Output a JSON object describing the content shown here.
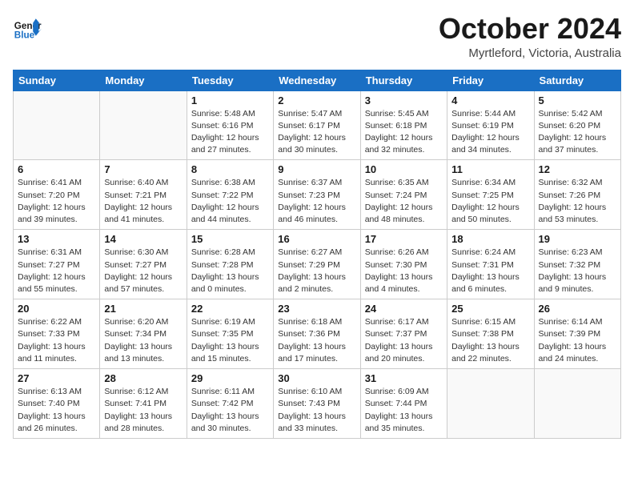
{
  "header": {
    "logo_line1": "General",
    "logo_line2": "Blue",
    "month": "October 2024",
    "location": "Myrtleford, Victoria, Australia"
  },
  "weekdays": [
    "Sunday",
    "Monday",
    "Tuesday",
    "Wednesday",
    "Thursday",
    "Friday",
    "Saturday"
  ],
  "weeks": [
    [
      {
        "day": "",
        "info": ""
      },
      {
        "day": "",
        "info": ""
      },
      {
        "day": "1",
        "info": "Sunrise: 5:48 AM\nSunset: 6:16 PM\nDaylight: 12 hours\nand 27 minutes."
      },
      {
        "day": "2",
        "info": "Sunrise: 5:47 AM\nSunset: 6:17 PM\nDaylight: 12 hours\nand 30 minutes."
      },
      {
        "day": "3",
        "info": "Sunrise: 5:45 AM\nSunset: 6:18 PM\nDaylight: 12 hours\nand 32 minutes."
      },
      {
        "day": "4",
        "info": "Sunrise: 5:44 AM\nSunset: 6:19 PM\nDaylight: 12 hours\nand 34 minutes."
      },
      {
        "day": "5",
        "info": "Sunrise: 5:42 AM\nSunset: 6:20 PM\nDaylight: 12 hours\nand 37 minutes."
      }
    ],
    [
      {
        "day": "6",
        "info": "Sunrise: 6:41 AM\nSunset: 7:20 PM\nDaylight: 12 hours\nand 39 minutes."
      },
      {
        "day": "7",
        "info": "Sunrise: 6:40 AM\nSunset: 7:21 PM\nDaylight: 12 hours\nand 41 minutes."
      },
      {
        "day": "8",
        "info": "Sunrise: 6:38 AM\nSunset: 7:22 PM\nDaylight: 12 hours\nand 44 minutes."
      },
      {
        "day": "9",
        "info": "Sunrise: 6:37 AM\nSunset: 7:23 PM\nDaylight: 12 hours\nand 46 minutes."
      },
      {
        "day": "10",
        "info": "Sunrise: 6:35 AM\nSunset: 7:24 PM\nDaylight: 12 hours\nand 48 minutes."
      },
      {
        "day": "11",
        "info": "Sunrise: 6:34 AM\nSunset: 7:25 PM\nDaylight: 12 hours\nand 50 minutes."
      },
      {
        "day": "12",
        "info": "Sunrise: 6:32 AM\nSunset: 7:26 PM\nDaylight: 12 hours\nand 53 minutes."
      }
    ],
    [
      {
        "day": "13",
        "info": "Sunrise: 6:31 AM\nSunset: 7:27 PM\nDaylight: 12 hours\nand 55 minutes."
      },
      {
        "day": "14",
        "info": "Sunrise: 6:30 AM\nSunset: 7:27 PM\nDaylight: 12 hours\nand 57 minutes."
      },
      {
        "day": "15",
        "info": "Sunrise: 6:28 AM\nSunset: 7:28 PM\nDaylight: 13 hours\nand 0 minutes."
      },
      {
        "day": "16",
        "info": "Sunrise: 6:27 AM\nSunset: 7:29 PM\nDaylight: 13 hours\nand 2 minutes."
      },
      {
        "day": "17",
        "info": "Sunrise: 6:26 AM\nSunset: 7:30 PM\nDaylight: 13 hours\nand 4 minutes."
      },
      {
        "day": "18",
        "info": "Sunrise: 6:24 AM\nSunset: 7:31 PM\nDaylight: 13 hours\nand 6 minutes."
      },
      {
        "day": "19",
        "info": "Sunrise: 6:23 AM\nSunset: 7:32 PM\nDaylight: 13 hours\nand 9 minutes."
      }
    ],
    [
      {
        "day": "20",
        "info": "Sunrise: 6:22 AM\nSunset: 7:33 PM\nDaylight: 13 hours\nand 11 minutes."
      },
      {
        "day": "21",
        "info": "Sunrise: 6:20 AM\nSunset: 7:34 PM\nDaylight: 13 hours\nand 13 minutes."
      },
      {
        "day": "22",
        "info": "Sunrise: 6:19 AM\nSunset: 7:35 PM\nDaylight: 13 hours\nand 15 minutes."
      },
      {
        "day": "23",
        "info": "Sunrise: 6:18 AM\nSunset: 7:36 PM\nDaylight: 13 hours\nand 17 minutes."
      },
      {
        "day": "24",
        "info": "Sunrise: 6:17 AM\nSunset: 7:37 PM\nDaylight: 13 hours\nand 20 minutes."
      },
      {
        "day": "25",
        "info": "Sunrise: 6:15 AM\nSunset: 7:38 PM\nDaylight: 13 hours\nand 22 minutes."
      },
      {
        "day": "26",
        "info": "Sunrise: 6:14 AM\nSunset: 7:39 PM\nDaylight: 13 hours\nand 24 minutes."
      }
    ],
    [
      {
        "day": "27",
        "info": "Sunrise: 6:13 AM\nSunset: 7:40 PM\nDaylight: 13 hours\nand 26 minutes."
      },
      {
        "day": "28",
        "info": "Sunrise: 6:12 AM\nSunset: 7:41 PM\nDaylight: 13 hours\nand 28 minutes."
      },
      {
        "day": "29",
        "info": "Sunrise: 6:11 AM\nSunset: 7:42 PM\nDaylight: 13 hours\nand 30 minutes."
      },
      {
        "day": "30",
        "info": "Sunrise: 6:10 AM\nSunset: 7:43 PM\nDaylight: 13 hours\nand 33 minutes."
      },
      {
        "day": "31",
        "info": "Sunrise: 6:09 AM\nSunset: 7:44 PM\nDaylight: 13 hours\nand 35 minutes."
      },
      {
        "day": "",
        "info": ""
      },
      {
        "day": "",
        "info": ""
      }
    ]
  ]
}
